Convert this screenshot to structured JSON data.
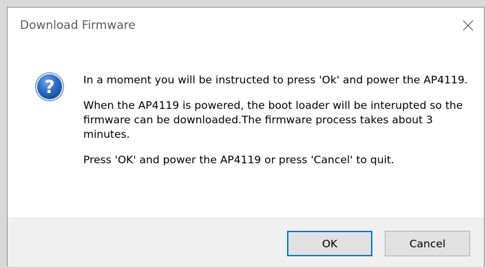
{
  "window": {
    "title": "Download Firmware",
    "close_icon": "close-icon"
  },
  "message": {
    "icon": "question-icon",
    "line1": "In a moment you will be instructed to press 'Ok' and power the AP4119.",
    "line2": "When the AP4119 is powered, the boot loader will be interupted so the firmware can be downloaded.The firmware process takes about 3 minutes.",
    "line3": "Press 'OK' and power the AP4119 or press 'Cancel' to quit."
  },
  "buttons": {
    "ok_label": "OK",
    "cancel_label": "Cancel"
  },
  "colors": {
    "accent": "#0078d7",
    "icon_blue": "#2f6dc2"
  }
}
